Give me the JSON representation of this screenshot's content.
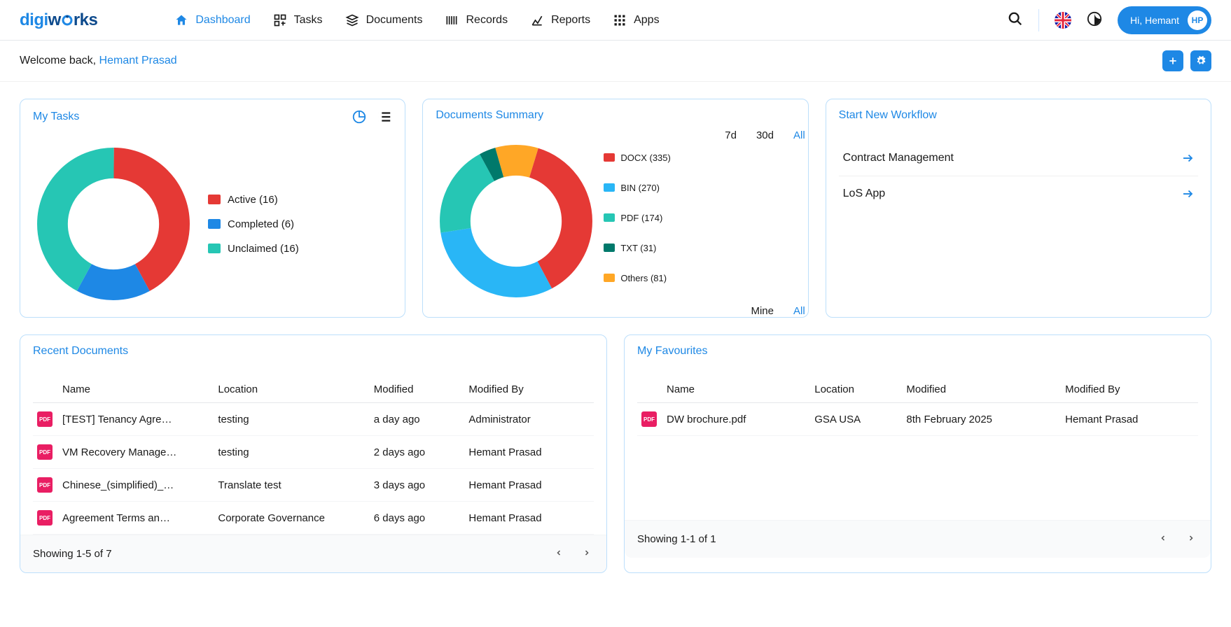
{
  "header": {
    "logo_part1": "digi",
    "logo_part2": "w",
    "logo_part3": "rks",
    "nav": [
      {
        "label": "Dashboard",
        "active": true
      },
      {
        "label": "Tasks",
        "active": false
      },
      {
        "label": "Documents",
        "active": false
      },
      {
        "label": "Records",
        "active": false
      },
      {
        "label": "Reports",
        "active": false
      },
      {
        "label": "Apps",
        "active": false
      }
    ],
    "user_greeting": "Hi, Hemant",
    "user_initials": "HP"
  },
  "subheader": {
    "welcome_prefix": "Welcome back, ",
    "username": "Hemant Prasad"
  },
  "tasks_card": {
    "title": "My Tasks",
    "legend": [
      {
        "label": "Active (16)",
        "color": "#e53935"
      },
      {
        "label": "Completed (6)",
        "color": "#1e88e5"
      },
      {
        "label": "Unclaimed (16)",
        "color": "#26c6b4"
      }
    ]
  },
  "docs_card": {
    "title": "Documents Summary",
    "range_top": [
      {
        "label": "7d",
        "active": false
      },
      {
        "label": "30d",
        "active": false
      },
      {
        "label": "All",
        "active": true
      }
    ],
    "range_bottom": [
      {
        "label": "Mine",
        "active": false
      },
      {
        "label": "All",
        "active": true
      }
    ],
    "legend": [
      {
        "label": "DOCX (335)",
        "color": "#e53935"
      },
      {
        "label": "BIN (270)",
        "color": "#29b6f6"
      },
      {
        "label": "PDF (174)",
        "color": "#26c6b4"
      },
      {
        "label": "TXT (31)",
        "color": "#00796b"
      },
      {
        "label": "Others (81)",
        "color": "#ffa726"
      }
    ]
  },
  "workflows_card": {
    "title": "Start New Workflow",
    "items": [
      "Contract Management",
      "LoS App"
    ]
  },
  "recent_card": {
    "title": "Recent Documents",
    "columns": [
      "Name",
      "Location",
      "Modified",
      "Modified By"
    ],
    "rows": [
      {
        "name": "[TEST] Tenancy Agre…",
        "location": "testing",
        "modified": "a day ago",
        "by": "Administrator"
      },
      {
        "name": "VM Recovery Manage…",
        "location": "testing",
        "modified": "2 days ago",
        "by": "Hemant Prasad"
      },
      {
        "name": "Chinese_(simplified)_…",
        "location": "Translate test",
        "modified": "3 days ago",
        "by": "Hemant Prasad"
      },
      {
        "name": "Agreement Terms an…",
        "location": "Corporate Governance",
        "modified": "6 days ago",
        "by": "Hemant Prasad"
      }
    ],
    "footer": "Showing 1-5 of 7"
  },
  "fav_card": {
    "title": "My Favourites",
    "columns": [
      "Name",
      "Location",
      "Modified",
      "Modified By"
    ],
    "rows": [
      {
        "name": "DW brochure.pdf",
        "location": "GSA USA",
        "modified": "8th February 2025",
        "by": "Hemant Prasad"
      }
    ],
    "footer": "Showing 1-1 of 1"
  },
  "chart_data": [
    {
      "type": "pie",
      "title": "My Tasks",
      "series": [
        {
          "name": "Active",
          "value": 16,
          "color": "#e53935"
        },
        {
          "name": "Completed",
          "value": 6,
          "color": "#1e88e5"
        },
        {
          "name": "Unclaimed",
          "value": 16,
          "color": "#26c6b4"
        }
      ]
    },
    {
      "type": "pie",
      "title": "Documents Summary",
      "series": [
        {
          "name": "DOCX",
          "value": 335,
          "color": "#e53935"
        },
        {
          "name": "BIN",
          "value": 270,
          "color": "#29b6f6"
        },
        {
          "name": "PDF",
          "value": 174,
          "color": "#26c6b4"
        },
        {
          "name": "TXT",
          "value": 31,
          "color": "#00796b"
        },
        {
          "name": "Others",
          "value": 81,
          "color": "#ffa726"
        }
      ]
    }
  ]
}
